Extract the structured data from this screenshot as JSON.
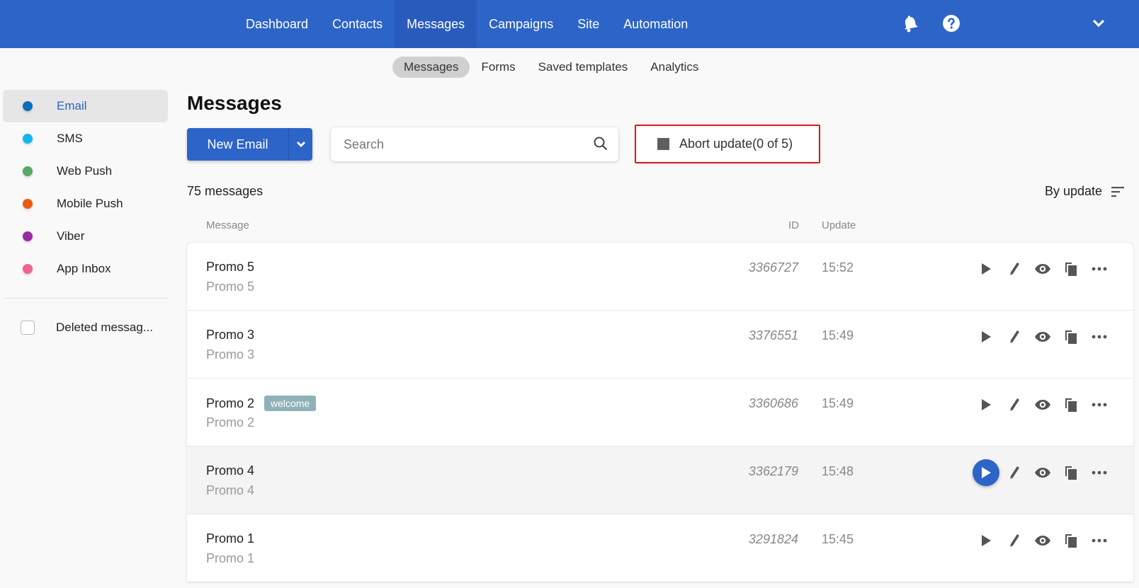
{
  "topnav": {
    "items": [
      {
        "label": "Dashboard",
        "active": false
      },
      {
        "label": "Contacts",
        "active": false
      },
      {
        "label": "Messages",
        "active": true
      },
      {
        "label": "Campaigns",
        "active": false
      },
      {
        "label": "Site",
        "active": false
      },
      {
        "label": "Automation",
        "active": false
      }
    ],
    "icons": [
      "bell-icon",
      "help-icon",
      "chevron-down-icon"
    ]
  },
  "subnav": {
    "items": [
      {
        "label": "Messages",
        "active": true
      },
      {
        "label": "Forms",
        "active": false
      },
      {
        "label": "Saved templates",
        "active": false
      },
      {
        "label": "Analytics",
        "active": false
      }
    ]
  },
  "sidebar": {
    "channels": [
      {
        "label": "Email",
        "color": "#0a6fb8",
        "active": true
      },
      {
        "label": "SMS",
        "color": "#13b6ee",
        "active": false
      },
      {
        "label": "Web Push",
        "color": "#55a865",
        "active": false
      },
      {
        "label": "Mobile Push",
        "color": "#ea5b14",
        "active": false
      },
      {
        "label": "Viber",
        "color": "#9b2aa6",
        "active": false
      },
      {
        "label": "App Inbox",
        "color": "#f06292",
        "active": false
      }
    ],
    "deleted_label": "Deleted messag...",
    "deleted_checked": false
  },
  "main": {
    "title": "Messages",
    "new_button_label": "New Email",
    "search_placeholder": "Search",
    "search_value": "",
    "abort_label": "Abort update(0 of 5)",
    "count_number": "75",
    "count_label": "messages",
    "sort_label": "By update",
    "columns": {
      "message": "Message",
      "id": "ID",
      "update": "Update"
    },
    "rows": [
      {
        "title": "Promo 5",
        "subtitle": "Promo 5",
        "tag": null,
        "id": "3366727",
        "time": "15:52",
        "hover": false
      },
      {
        "title": "Promo 3",
        "subtitle": "Promo 3",
        "tag": null,
        "id": "3376551",
        "time": "15:49",
        "hover": false
      },
      {
        "title": "Promo 2",
        "subtitle": "Promo 2",
        "tag": "welcome",
        "id": "3360686",
        "time": "15:49",
        "hover": false
      },
      {
        "title": "Promo 4",
        "subtitle": "Promo 4",
        "tag": null,
        "id": "3362179",
        "time": "15:48",
        "hover": true
      },
      {
        "title": "Promo 1",
        "subtitle": "Promo 1",
        "tag": null,
        "id": "3291824",
        "time": "15:45",
        "hover": false
      }
    ]
  },
  "colors": {
    "brand": "#2c64c8",
    "highlight_border": "#e0141e",
    "tag_bg": "#8fb2b8"
  }
}
